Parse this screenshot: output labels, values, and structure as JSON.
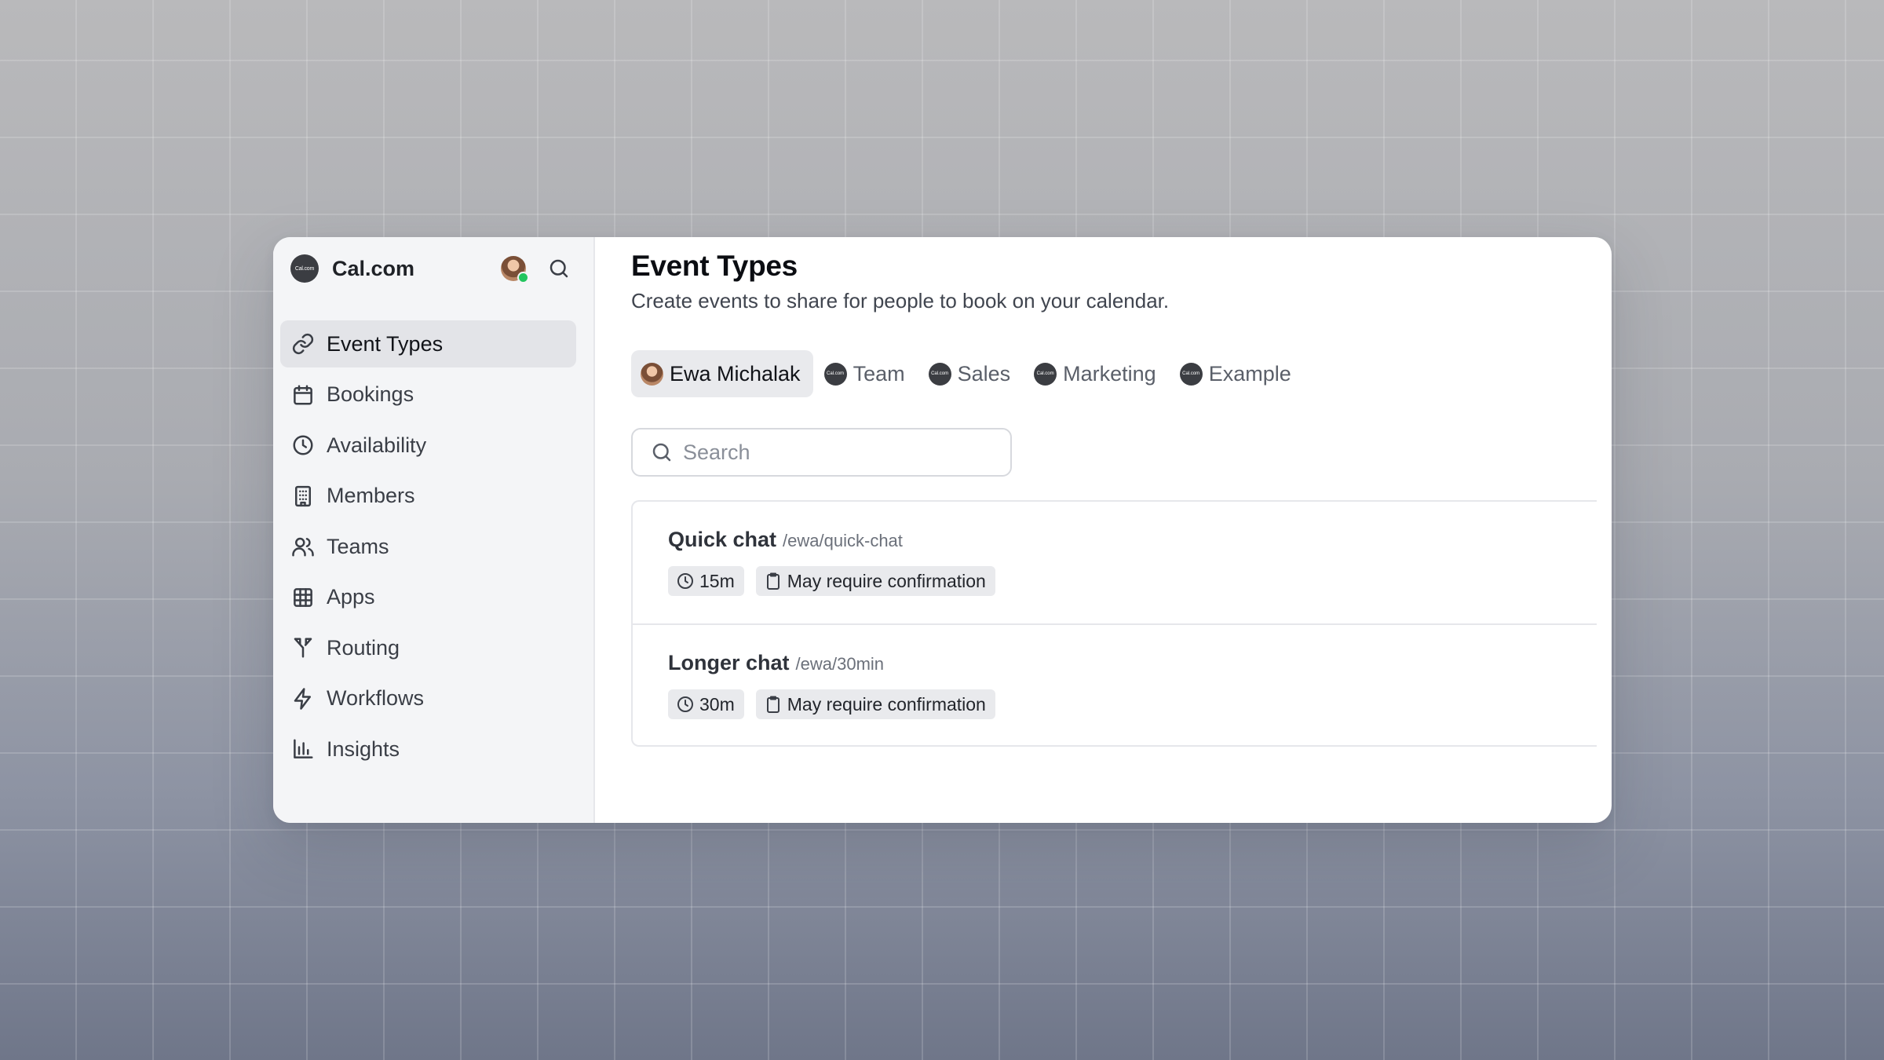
{
  "brand": {
    "logo_text": "Cal.com",
    "name": "Cal.com"
  },
  "header": {
    "avatar": "user-avatar",
    "status": "online",
    "search_icon": "search-icon"
  },
  "sidebar": {
    "items": [
      {
        "label": "Event Types",
        "icon": "link-icon",
        "active": true
      },
      {
        "label": "Bookings",
        "icon": "calendar-icon",
        "active": false
      },
      {
        "label": "Availability",
        "icon": "clock-icon",
        "active": false
      },
      {
        "label": "Members",
        "icon": "building-icon",
        "active": false
      },
      {
        "label": "Teams",
        "icon": "users-icon",
        "active": false
      },
      {
        "label": "Apps",
        "icon": "grid-icon",
        "active": false
      },
      {
        "label": "Routing",
        "icon": "split-icon",
        "active": false
      },
      {
        "label": "Workflows",
        "icon": "zap-icon",
        "active": false
      },
      {
        "label": "Insights",
        "icon": "bar-chart-icon",
        "active": false
      }
    ]
  },
  "main": {
    "title": "Event Types",
    "subtitle": "Create events to share for people to book on your calendar.",
    "tabs": [
      {
        "label": "Ewa Michalak",
        "active": true
      },
      {
        "label": "Team",
        "active": false
      },
      {
        "label": "Sales",
        "active": false
      },
      {
        "label": "Marketing",
        "active": false
      },
      {
        "label": "Example",
        "active": false
      }
    ],
    "tab_logo_text": "Cal.com",
    "search": {
      "placeholder": "Search",
      "value": ""
    },
    "events": [
      {
        "title": "Quick chat",
        "slug": "/ewa/quick-chat",
        "duration": "15m",
        "confirmation": "May require confirmation"
      },
      {
        "title": "Longer chat",
        "slug": "/ewa/30min",
        "duration": "30m",
        "confirmation": "May require confirmation"
      }
    ]
  },
  "colors": {
    "accent_online": "#22c55e",
    "sidebar_bg": "#f4f5f7",
    "active_bg": "#e3e4e8"
  }
}
